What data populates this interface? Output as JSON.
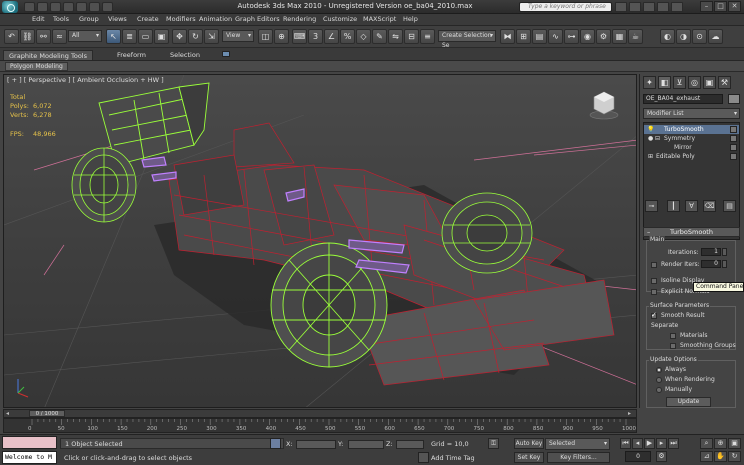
{
  "window": {
    "title": "Autodesk 3ds Max  2010   - Unregistered Version    oe_ba04_2010.max",
    "help_search_placeholder": "Type a keyword or phrase"
  },
  "menu": [
    "Edit",
    "Tools",
    "Group",
    "Views",
    "Create",
    "Modifiers",
    "Animation",
    "Graph Editors",
    "Rendering",
    "Customize",
    "MAXScript",
    "Help"
  ],
  "toolbar": {
    "selection_filter": "All",
    "ref_coord": "View",
    "named_selection": "Create Selection Se"
  },
  "ribbon": {
    "tabs": [
      "Graphite Modeling Tools",
      "Freeform",
      "Selection"
    ],
    "active_panel": "Polygon Modeling"
  },
  "viewport": {
    "label": "[ + ] [ Perspective ] [ Ambient Occlusion + HW ]",
    "stats": {
      "total_label": "Total",
      "polys_label": "Polys:",
      "polys_value": "6,072",
      "verts_label": "Verts:",
      "verts_value": "6,278",
      "fps_label": "FPS:",
      "fps_value": "48,966"
    }
  },
  "command_panel": {
    "object_name": "OE_BA04_exhaust",
    "modifier_list": "Modifier List",
    "stack": [
      "TurboSmooth",
      "Symmetry",
      "Mirror",
      "Editable Poly"
    ],
    "rollout_title": "TurboSmooth",
    "main_group": "Main",
    "iterations_label": "Iterations:",
    "iterations_value": "1",
    "render_iters_label": "Render Iters:",
    "render_iters_value": "0",
    "isoline_label": "Isoline Display",
    "explicit_label": "Explicit Normals",
    "surface_group": "Surface Parameters",
    "smooth_result_label": "Smooth Result",
    "separate_label": "Separate",
    "materials_label": "Materials",
    "smoothing_groups_label": "Smoothing Groups",
    "update_group": "Update Options",
    "always_label": "Always",
    "when_rendering_label": "When Rendering",
    "manually_label": "Manually",
    "update_button": "Update",
    "tooltip": "Command Panel"
  },
  "timeline": {
    "frame_display": "0 / 1000",
    "ticks": [
      "0",
      "50",
      "100",
      "150",
      "200",
      "250",
      "300",
      "350",
      "400",
      "450",
      "500",
      "550",
      "600",
      "650",
      "700",
      "750",
      "800",
      "850",
      "900",
      "950",
      "1000"
    ]
  },
  "status": {
    "maxscript_text": "Welcome to M",
    "selection_info": "1 Object Selected",
    "prompt": "Click or click-and-drag to select objects",
    "x_label": "X:",
    "y_label": "Y:",
    "z_label": "Z:",
    "grid": "Grid = 10,0",
    "add_time_tag": "Add Time Tag",
    "auto_key": "Auto Key",
    "set_key": "Set Key",
    "key_mode": "Selected",
    "key_filters": "Key Filters...",
    "frame": "0"
  },
  "colors": {
    "viewport_bg": "#424242",
    "wire_red": "#c02030",
    "wire_green": "#9aff3a",
    "wire_violet": "#c080ff",
    "stats_yellow": "#e6c24a",
    "stack_selected": "#5a7292"
  },
  "icons": {
    "app": "3ds-max-logo-icon",
    "viewcube": "viewcube-icon"
  }
}
